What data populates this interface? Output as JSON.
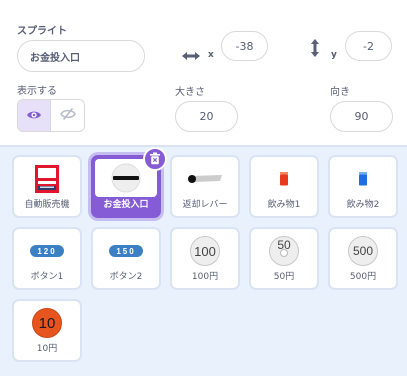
{
  "info": {
    "sprite_label": "スプライト",
    "sprite_name": "お金投入口",
    "x_label": "x",
    "x_value": "-38",
    "y_label": "y",
    "y_value": "-2",
    "show_label": "表示する",
    "size_label": "大きさ",
    "size_value": "20",
    "direction_label": "向き",
    "direction_value": "90"
  },
  "sprites": [
    {
      "name": "自動販売機",
      "icon": "vending-machine-icon"
    },
    {
      "name": "お金投入口",
      "icon": "coin-slot-icon",
      "selected": true
    },
    {
      "name": "返却レバー",
      "icon": "return-lever-icon"
    },
    {
      "name": "飲み物1",
      "icon": "red-drink-icon"
    },
    {
      "name": "飲み物2",
      "icon": "blue-drink-icon"
    },
    {
      "name": "ボタン1",
      "icon": "button-120-icon",
      "thumb_text": "120"
    },
    {
      "name": "ボタン2",
      "icon": "button-150-icon",
      "thumb_text": "150"
    },
    {
      "name": "100円",
      "icon": "coin-100-icon",
      "thumb_text": "100"
    },
    {
      "name": "50円",
      "icon": "coin-50-icon",
      "thumb_text": "50"
    },
    {
      "name": "500円",
      "icon": "coin-500-icon",
      "thumb_text": "500"
    },
    {
      "name": "10円",
      "icon": "coin-10-icon",
      "thumb_text": "10"
    }
  ],
  "colors": {
    "accent": "#855cd6",
    "panel_bg": "#e9f1fc",
    "text": "#575e75"
  }
}
